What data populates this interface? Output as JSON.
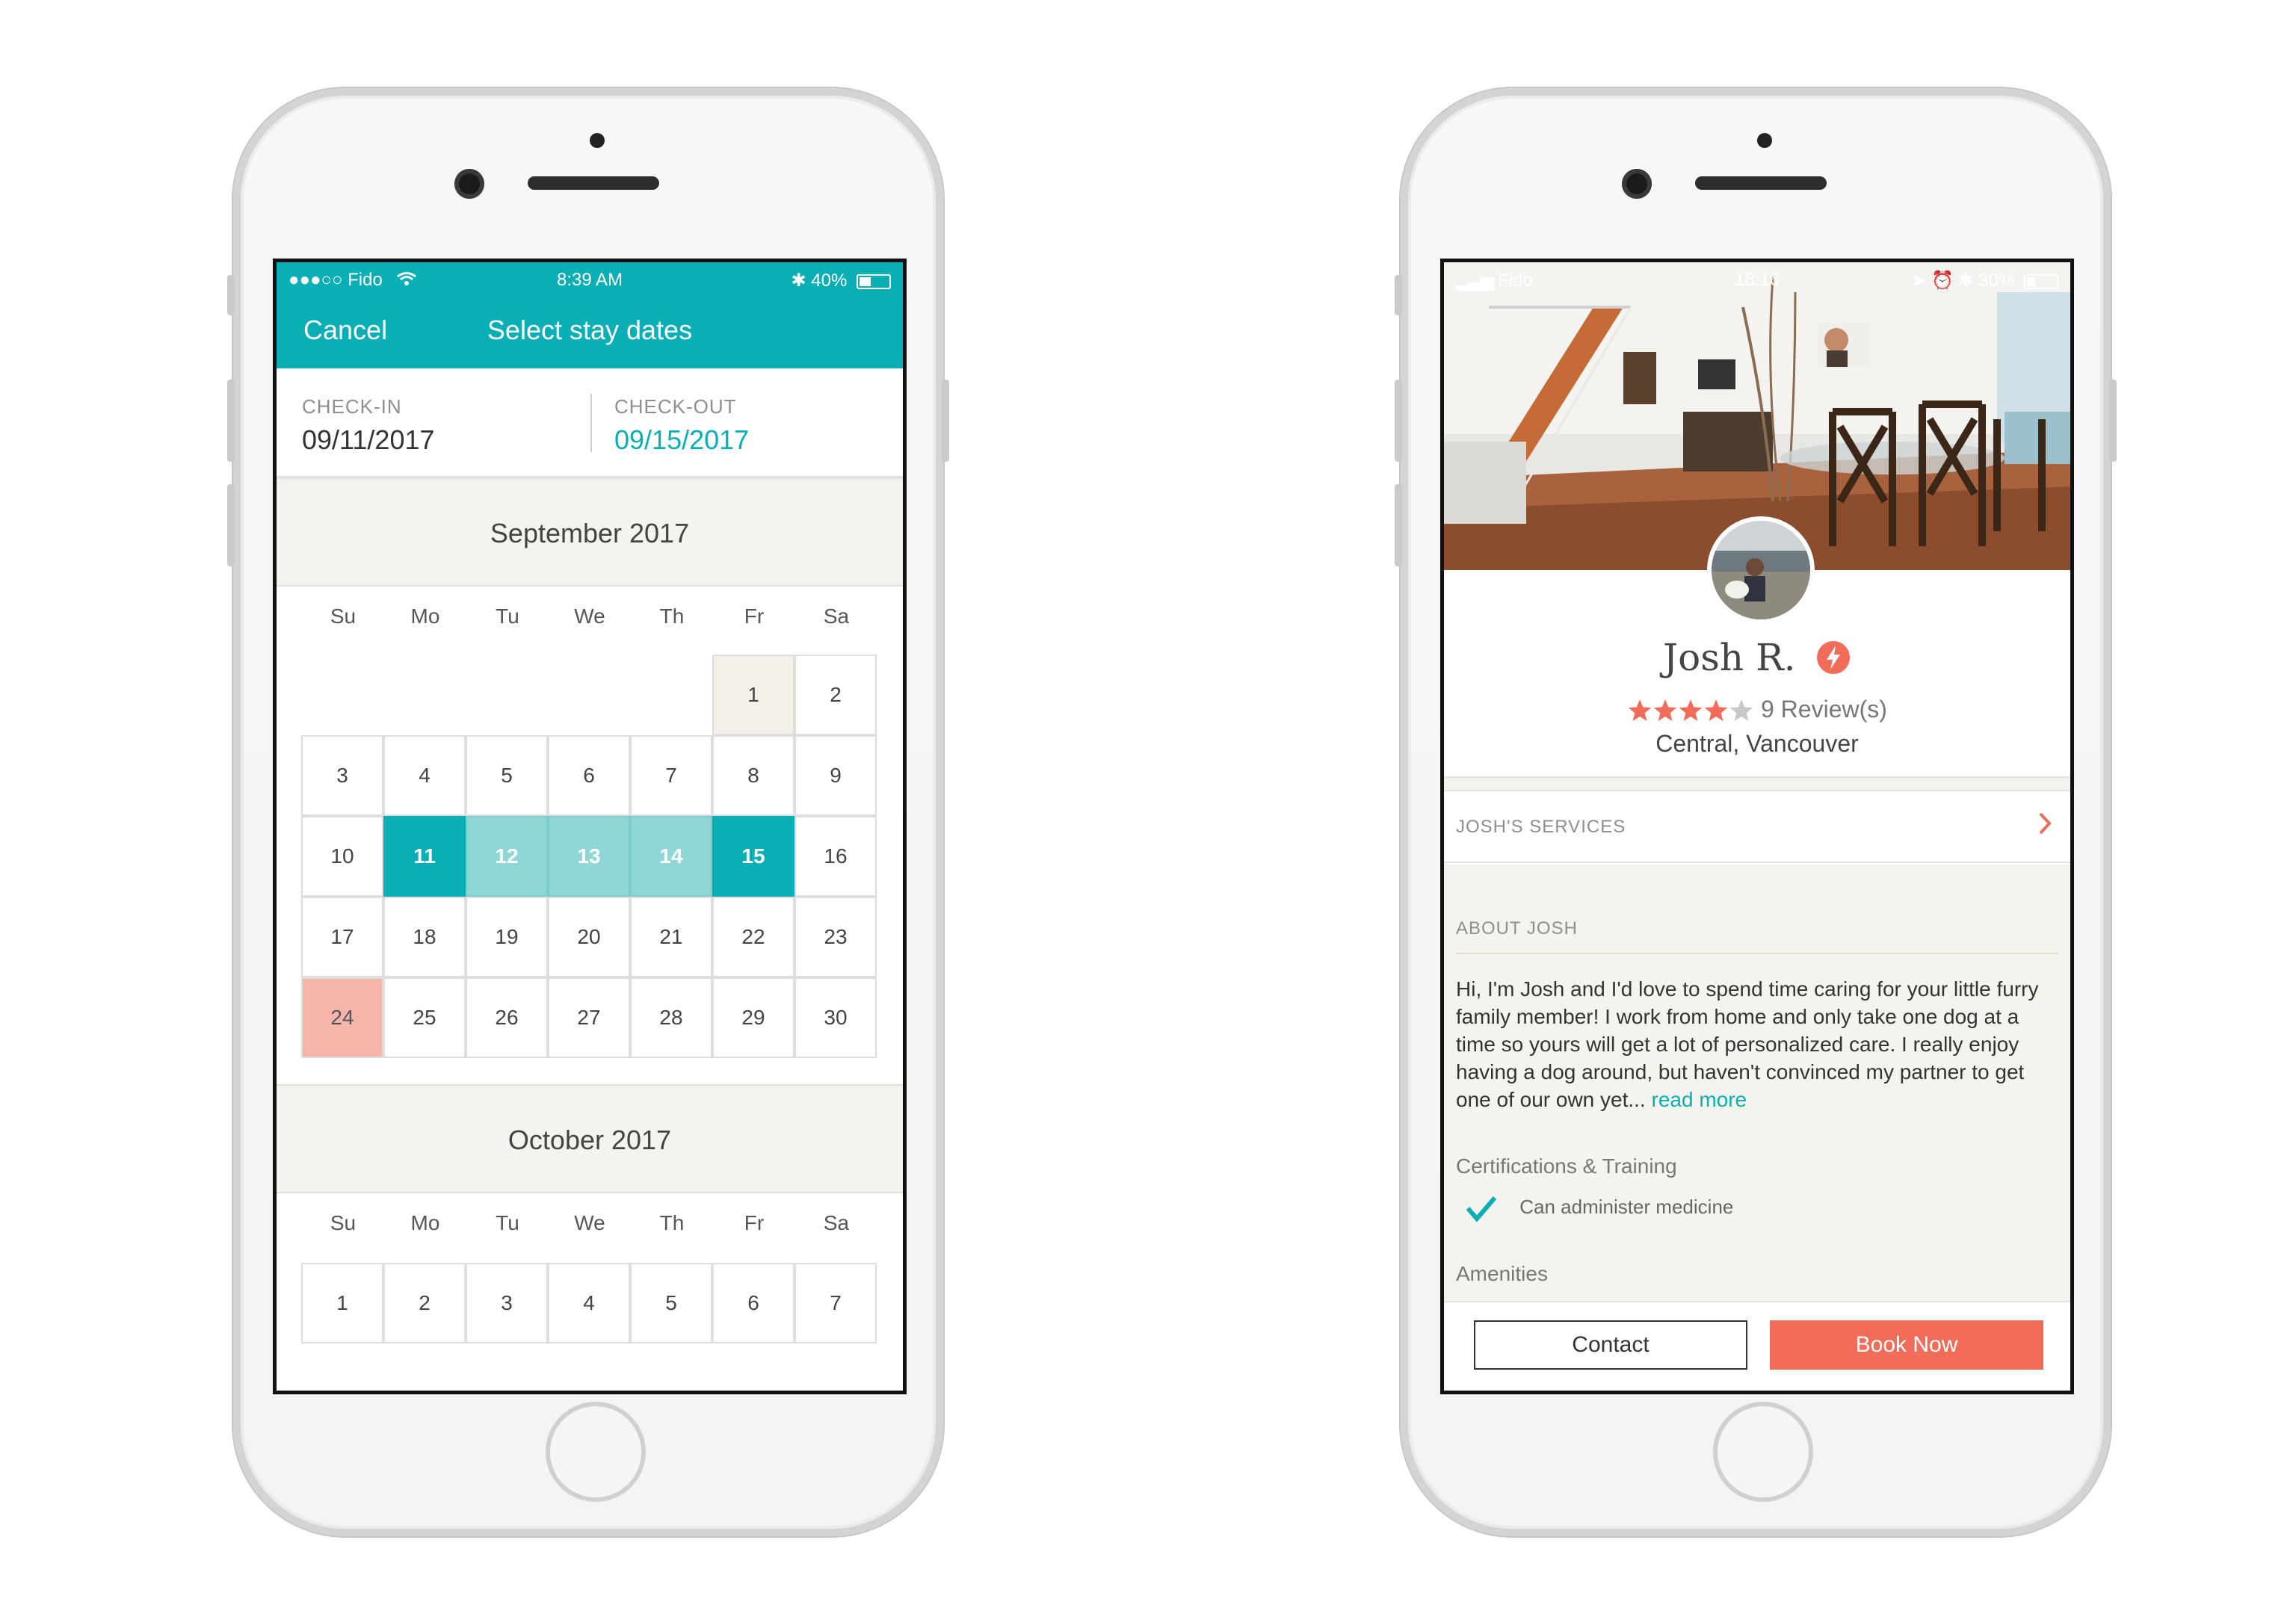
{
  "left_phone": {
    "status": {
      "carrier": "●●●○○ Fido",
      "time": "8:39 AM",
      "battery": "40%",
      "battery_level": 0.4
    },
    "header": {
      "cancel_label": "Cancel",
      "title": "Select stay dates"
    },
    "check_in": {
      "label": "CHECK-IN",
      "value": "09/11/2017"
    },
    "check_out": {
      "label": "CHECK-OUT",
      "value": "09/15/2017"
    },
    "weekdays": [
      "Su",
      "Mo",
      "Tu",
      "We",
      "Th",
      "Fr",
      "Sa"
    ],
    "september": {
      "title": "September 2017",
      "rows": [
        [
          "",
          "",
          "",
          "",
          "",
          "1",
          "2"
        ],
        [
          "3",
          "4",
          "5",
          "6",
          "7",
          "8",
          "9"
        ],
        [
          "10",
          "11",
          "12",
          "13",
          "14",
          "15",
          "16"
        ],
        [
          "17",
          "18",
          "19",
          "20",
          "21",
          "22",
          "23"
        ],
        [
          "24",
          "25",
          "26",
          "27",
          "28",
          "29",
          "30"
        ]
      ],
      "check_in_day": "11",
      "check_out_day": "15",
      "range_days": [
        "12",
        "13",
        "14"
      ],
      "highlight_day": "24",
      "muted_day": "1"
    },
    "october": {
      "title": "October 2017",
      "rows": [
        [
          "1",
          "2",
          "3",
          "4",
          "5",
          "6",
          "7"
        ]
      ]
    }
  },
  "right_phone": {
    "status": {
      "carrier": "Fido",
      "time": "18:16",
      "battery": "30%",
      "battery_level": 0.3
    },
    "profile": {
      "name": "Josh R.",
      "rating": 4,
      "rating_max": 5,
      "reviews": "9 Review(s)",
      "location": "Central, Vancouver"
    },
    "services_label": "JOSH'S SERVICES",
    "about": {
      "heading": "ABOUT JOSH",
      "text": "Hi, I'm Josh and I'd love to spend time caring for your little furry family member! I work from home and only take one dog at a time so yours will get a lot of personalized care. I really enjoy having a dog around, but haven't convinced my partner to get one of our own yet...",
      "read_more": "read more"
    },
    "certifications": {
      "heading": "Certifications & Training",
      "items": [
        "Can administer medicine"
      ]
    },
    "amenities_heading": "Amenities",
    "buttons": {
      "contact": "Contact",
      "book": "Book Now"
    },
    "colors": {
      "accent": "#f26c5a",
      "teal": "#0aafb5"
    }
  }
}
